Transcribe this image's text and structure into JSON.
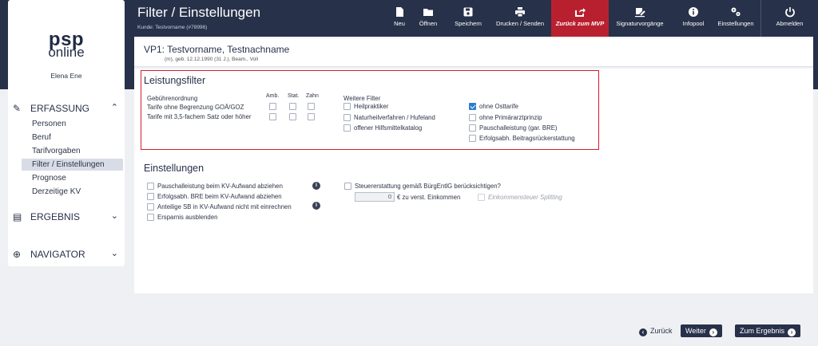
{
  "header": {
    "title": "Filter / Einstellungen",
    "subtitle": "Kunde: Testvorname (#78996)",
    "toolbar": [
      {
        "label": "Neu",
        "icon": "new-document-icon"
      },
      {
        "label": "Öffnen",
        "icon": "folder-open-icon"
      },
      {
        "label": "Speichern",
        "icon": "save-icon"
      },
      {
        "label": "Drucken / Senden",
        "icon": "print-icon"
      },
      {
        "label": "Zurück zum MVP",
        "icon": "share-arrow-icon"
      },
      {
        "label": "Signaturvorgänge",
        "icon": "signature-icon"
      },
      {
        "label": "Infopool",
        "icon": "info-icon"
      },
      {
        "label": "Einstellungen",
        "icon": "gears-icon"
      },
      {
        "label": "Abmelden",
        "icon": "power-icon"
      }
    ],
    "accent": "#b9202f"
  },
  "sidebar": {
    "logo_top": "psp",
    "logo_bottom": "online",
    "user": "Elena Ene",
    "sections": [
      {
        "label": "ERFASSUNG",
        "icon": "edit-icon",
        "chevron": "^",
        "items": [
          "Personen",
          "Beruf",
          "Tarifvorgaben",
          "Filter / Einstellungen",
          "Prognose",
          "Derzeitige KV"
        ],
        "selected": "Filter / Einstellungen"
      },
      {
        "label": "ERGEBNIS",
        "icon": "list-icon",
        "chevron": "v"
      },
      {
        "label": "NAVIGATOR",
        "icon": "crosshair-icon",
        "chevron": "v"
      }
    ]
  },
  "person": {
    "name": "VP1: Testvorname, Testnachname",
    "details": "(m), geb. 12.12.1990 (31 J.), Beam., Voll"
  },
  "leistungsfilter": {
    "title": "Leistungsfilter",
    "gebuehren_label": "Gebührenordnung",
    "columns": [
      "Amb.",
      "Stat.",
      "Zahn"
    ],
    "rows": [
      {
        "label": "Tarife ohne Begrenzung GOÄ/GOZ"
      },
      {
        "label": "Tarife mit 3,5-fachem Satz oder höher"
      }
    ],
    "weitere_label": "Weitere Filter",
    "weitere": [
      {
        "label": "Heilpraktiker",
        "checked": false
      },
      {
        "label": "Naturheilverfahren / Hufeland",
        "checked": false
      },
      {
        "label": "offener Hilfsmittelkatalog",
        "checked": false
      }
    ],
    "right": [
      {
        "label": "ohne Osttarife",
        "checked": true
      },
      {
        "label": "ohne Primärarztprinzip",
        "checked": false
      },
      {
        "label": "Pauschalleistung (gar. BRE)",
        "checked": false
      },
      {
        "label": "Erfolgsabh. Beitragsrückerstattung",
        "checked": false
      }
    ]
  },
  "einstellungen": {
    "title": "Einstellungen",
    "left": [
      {
        "label": "Pauschalleistung beim KV-Aufwand abziehen",
        "info": true
      },
      {
        "label": "Erfolgsabh. BRE beim KV-Aufwand abziehen",
        "info": false
      },
      {
        "label": "Anteilige SB in KV-Aufwand nicht mit einrechnen",
        "info": true
      },
      {
        "label": "Ersparnis ausblenden",
        "info": false
      }
    ],
    "steuer_label": "Steuererstattung gemäß BürgEntlG berücksichtigen?",
    "einkommen_value": "0",
    "einkommen_suffix": "€ zu verst. Einkommen",
    "splitting_label": "Einkommensteuer Splitting"
  },
  "footer": {
    "back": "Zurück",
    "next": "Weiter",
    "result": "Zum Ergebnis"
  }
}
